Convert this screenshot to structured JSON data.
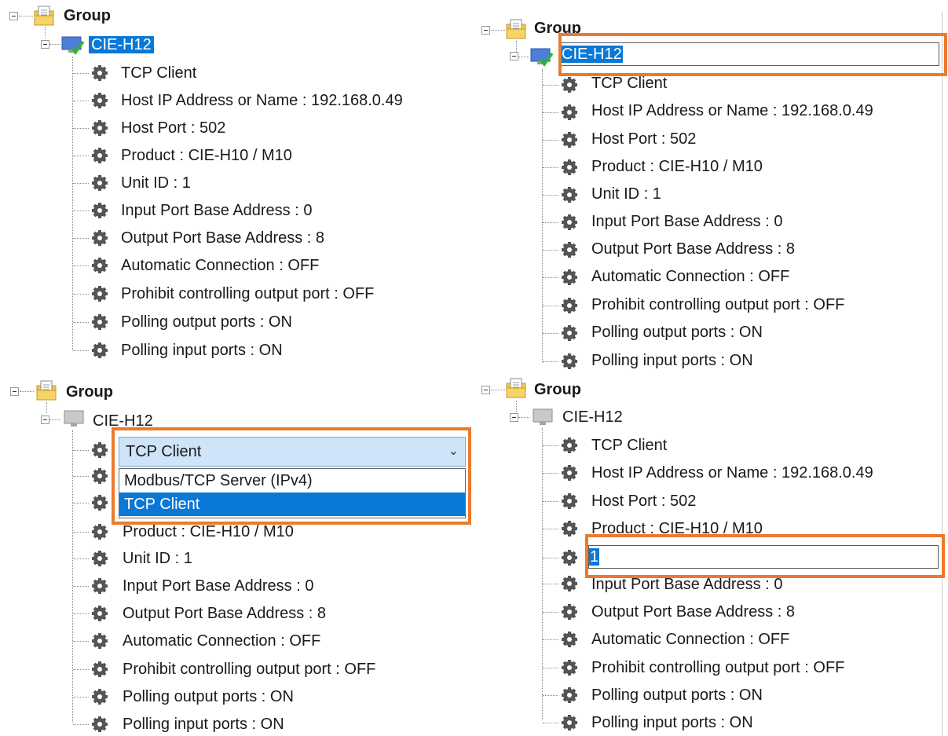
{
  "group_label": "Group",
  "device_label": "CIE-H12",
  "properties": [
    "TCP Client",
    "Host IP Address or Name : 192.168.0.49",
    "Host Port : 502",
    "Product : CIE-H10 / M10",
    "Unit ID : 1",
    "Input Port Base Address : 0",
    "Output Port Base Address : 8",
    "Automatic Connection : OFF",
    "Prohibit controlling output port : OFF",
    "Polling output ports : ON",
    "Polling input ports : ON"
  ],
  "combo": {
    "value": "TCP Client",
    "options": [
      "Modbus/TCP Server (IPv4)",
      "TCP Client"
    ],
    "selected_index": 1
  },
  "edit_unit_id_value": "1",
  "colors": {
    "selection": "#0a78d7",
    "highlight": "#ec7a2c",
    "combo_bg": "#cfe4f8"
  },
  "icons": {
    "group": "folder-document-icon",
    "device_connected": "monitor-check-icon",
    "device_disconnected": "monitor-gray-icon",
    "property": "gear-icon",
    "combo": "chevron-down-icon"
  }
}
